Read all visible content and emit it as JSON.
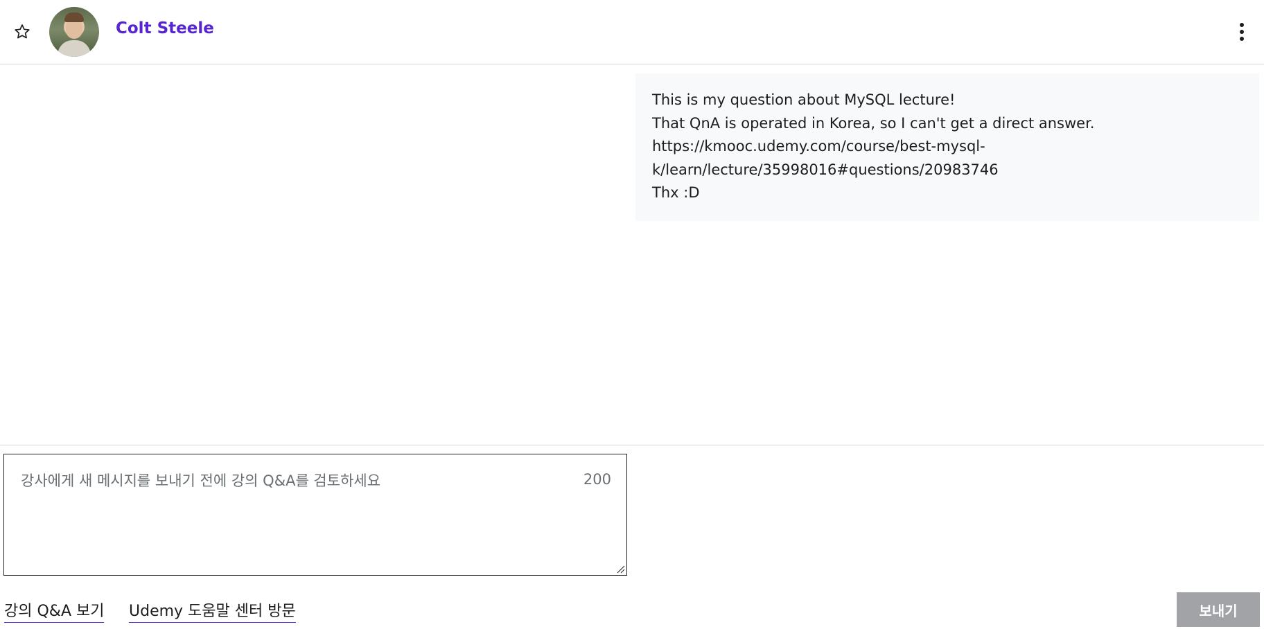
{
  "header": {
    "instructor_name": "Colt Steele",
    "icons": {
      "favorite": "star-outline-icon",
      "more": "more-vertical-icon"
    }
  },
  "message": {
    "lines": [
      "This is my question about MySQL lecture!",
      "That QnA is operated in Korea, so I can't get a direct answer.",
      "https://kmooc.udemy.com/course/best-mysql-",
      "k/learn/lecture/35998016#questions/20983746",
      "Thx :D"
    ]
  },
  "compose": {
    "placeholder": "강사에게 새 메시지를 보내기 전에 강의 Q&A를 검토하세요",
    "value": "",
    "char_count": "200"
  },
  "footer": {
    "qa_link": "강의 Q&A 보기",
    "help_link": "Udemy 도움말 센터 방문",
    "send_label": "보내기"
  },
  "colors": {
    "brand": "#5624d0",
    "bubble_bg": "#f7f9fa",
    "send_disabled": "#a1a3a6"
  }
}
